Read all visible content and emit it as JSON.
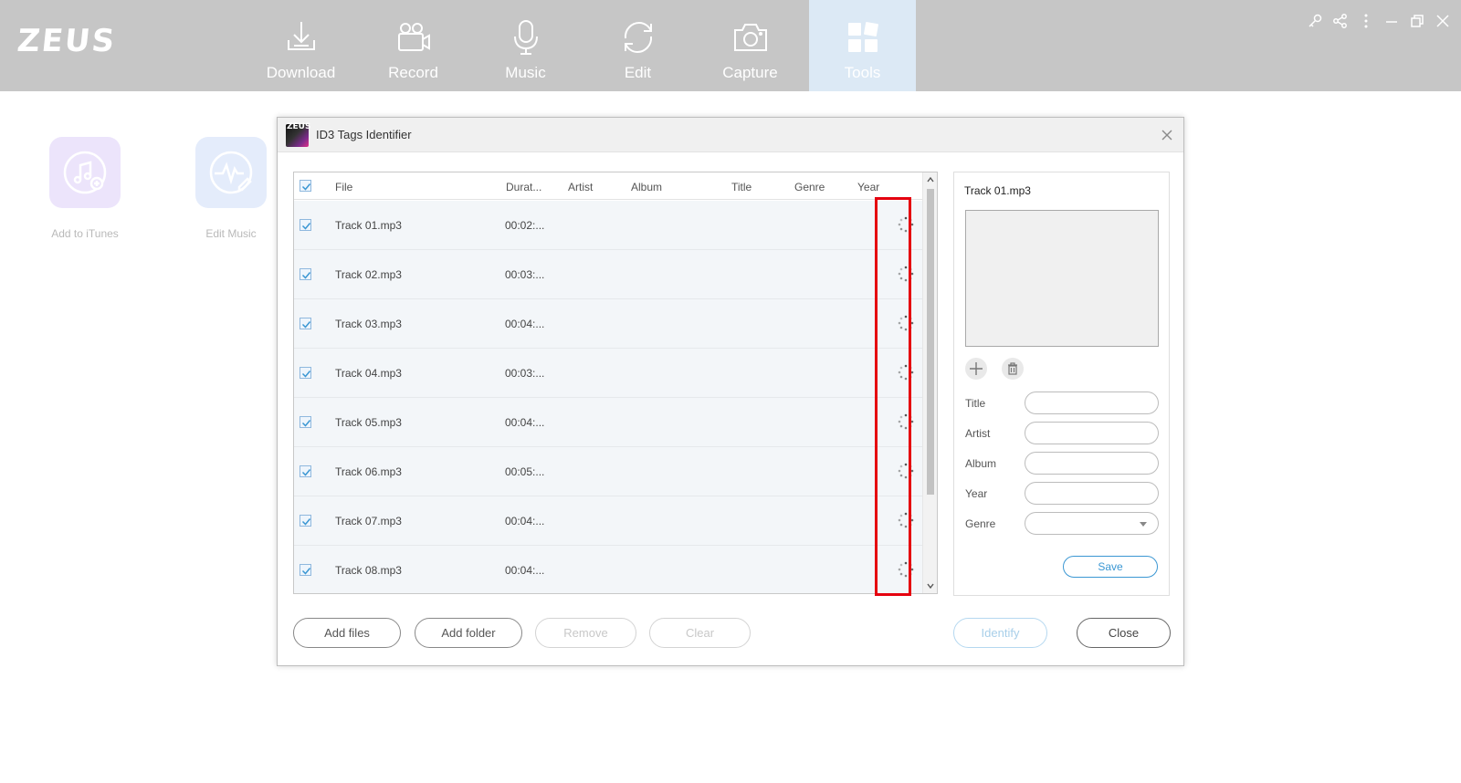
{
  "app": {
    "logo_text": "ZEUS"
  },
  "nav": {
    "tabs": [
      {
        "label": "Download",
        "icon": "download-icon"
      },
      {
        "label": "Record",
        "icon": "video-camera-icon"
      },
      {
        "label": "Music",
        "icon": "microphone-icon"
      },
      {
        "label": "Edit",
        "icon": "refresh-edit-icon"
      },
      {
        "label": "Capture",
        "icon": "camera-icon"
      },
      {
        "label": "Tools",
        "icon": "grid-tools-icon",
        "active": true
      }
    ]
  },
  "window_controls": [
    "key-icon",
    "share-icon",
    "more-icon",
    "minimize-icon",
    "restore-icon",
    "close-icon"
  ],
  "tools": [
    {
      "label": "Add to iTunes",
      "icon": "music-add-icon",
      "color": "#ece4fb"
    },
    {
      "label": "Edit Music",
      "icon": "waveform-edit-icon",
      "color": "#e4ecfb"
    }
  ],
  "dialog": {
    "title": "ID3 Tags Identifier",
    "logo_text": "ZEUS",
    "columns": {
      "file": "File",
      "duration": "Durat...",
      "artist": "Artist",
      "album": "Album",
      "title": "Title",
      "genre": "Genre",
      "year": "Year"
    },
    "rows": [
      {
        "file": "Track 01.mp3",
        "duration": "00:02:...",
        "checked": true,
        "status": "loading"
      },
      {
        "file": "Track 02.mp3",
        "duration": "00:03:...",
        "checked": true,
        "status": "loading"
      },
      {
        "file": "Track 03.mp3",
        "duration": "00:04:...",
        "checked": true,
        "status": "loading"
      },
      {
        "file": "Track 04.mp3",
        "duration": "00:03:...",
        "checked": true,
        "status": "loading"
      },
      {
        "file": "Track 05.mp3",
        "duration": "00:04:...",
        "checked": true,
        "status": "loading"
      },
      {
        "file": "Track 06.mp3",
        "duration": "00:05:...",
        "checked": true,
        "status": "loading"
      },
      {
        "file": "Track 07.mp3",
        "duration": "00:04:...",
        "checked": true,
        "status": "loading"
      },
      {
        "file": "Track 08.mp3",
        "duration": "00:04:...",
        "checked": true,
        "status": "loading"
      }
    ],
    "side": {
      "filename": "Track 01.mp3",
      "fields": {
        "title_label": "Title",
        "artist_label": "Artist",
        "album_label": "Album",
        "year_label": "Year",
        "genre_label": "Genre",
        "title_value": "",
        "artist_value": "",
        "album_value": "",
        "year_value": "",
        "genre_value": ""
      },
      "save_label": "Save"
    },
    "buttons": {
      "add_files": "Add files",
      "add_folder": "Add folder",
      "remove": "Remove",
      "clear": "Clear",
      "identify": "Identify",
      "close": "Close"
    }
  },
  "colors": {
    "topbar": "#c6c6c6",
    "active_tab": "#dce9f5",
    "accent": "#3b97d3",
    "highlight": "#e5000f"
  }
}
